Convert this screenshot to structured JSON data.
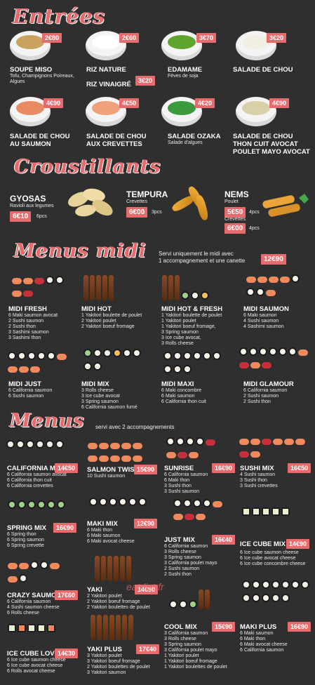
{
  "sections": {
    "entrees": "Entrées",
    "croustillants": "Croustillants",
    "menus_midi": "Menus midi",
    "menus": "Menus"
  },
  "entrees": [
    {
      "name": "SOUPE MISO",
      "sub": "Tofu, Champignons Poireaux, Algues",
      "price": "2€80",
      "color": "#c9a35d"
    },
    {
      "name": "RIZ NATURE",
      "sub": "",
      "price": "2€60",
      "color": "#ffffff"
    },
    {
      "name": "EDAMAME",
      "sub": "Fèves de soja",
      "price": "3€70",
      "color": "#5fa52c"
    },
    {
      "name": "SALADE DE CHOU",
      "sub": "",
      "price": "3€20",
      "color": "#f2efe3"
    },
    {
      "name": "SALADE DE CHOU AU SAUMON",
      "sub": "",
      "price": "4€90",
      "color": "#e88b63"
    },
    {
      "name": "SALADE DE CHOU AUX CREVETTES",
      "sub": "",
      "price": "4€50",
      "color": "#f0a07a"
    },
    {
      "name": "SALADE OZAKA",
      "sub": "Salade d'algues",
      "price": "4€20",
      "color": "#3b9a3c"
    },
    {
      "name": "SALADE DE CHOU THON CUIT AVOCAT POULET MAYO AVOCAT",
      "sub": "",
      "price": "4€90",
      "color": "#d9cfa9"
    }
  ],
  "riz_vinaigre": {
    "name": "RIZ VINAIGRÉ",
    "price": "3€20"
  },
  "croustillants": {
    "gyosas": {
      "name": "GYOSAS",
      "sub": "Ravioli aux legumes",
      "price": "6€10",
      "qty": "6pcs"
    },
    "tempura": {
      "name": "TEMPURA",
      "sub": "Crevettes",
      "price": "6€00",
      "qty": "3pcs"
    },
    "nems": {
      "name": "NEMS",
      "sub1": "Poulet",
      "price1": "5€50",
      "qty1": "4pcs",
      "sub2": "Crevettes",
      "price2": "6€00",
      "qty2": "4pcs"
    }
  },
  "menus_midi": {
    "note1": "Servi uniquement le midi avec",
    "note2": "1 accompagnement et une canette",
    "price": "12€90",
    "items": [
      {
        "name": "MIDI FRESH",
        "lines": [
          "6 Maki saumon avocat",
          "2 Sushi saumon",
          "2 Sushi thon",
          "3 Sashimi saumon",
          "3 Sashimi thon"
        ]
      },
      {
        "name": "MIDI HOT",
        "lines": [
          "1 Yakitori boulette de poulet",
          "2 Yakitori poulet",
          "2 Yakitori boeuf fromage"
        ]
      },
      {
        "name": "MIDI HOT & FRESH",
        "lines": [
          "1 Yakitori boulette de poulet",
          "1 Yakitori poulet",
          "1 Yakitori boeuf fromage,",
          "3 Spring saumon",
          "3 Ice cube avocat,",
          "3 Rolls cheese"
        ]
      },
      {
        "name": "MIDI SAUMON",
        "lines": [
          "6 Maki saumon",
          "4 Sushi saumon",
          "4 Sashimi saumon"
        ]
      },
      {
        "name": "MIDI JUST",
        "lines": [
          "6 California saumon",
          "6 Sushi saumon"
        ]
      },
      {
        "name": "MIDI MIX",
        "lines": [
          "3 Rolls cheese",
          "3 Ice cube avocat",
          "3 Spring saumon",
          "6 California saumon fumé"
        ]
      },
      {
        "name": "MIDI MAXI",
        "lines": [
          "6 Maki concombre",
          "6 Maki saumon",
          "6 California thon cuit"
        ]
      },
      {
        "name": "MIDI GLAMOUR",
        "lines": [
          "6 California saumon",
          "2 Sushi saumon",
          "2 Sushi thon"
        ]
      }
    ]
  },
  "menus": {
    "note": "servi avec 2 accompagnements",
    "items": [
      {
        "name": "CALIFORNIA MIX",
        "price": "14€50",
        "lines": [
          "6 California saumon avocat",
          "6 California thon cuit",
          "6 California crevettes"
        ]
      },
      {
        "name": "SALMON TWIST",
        "price": "15€90",
        "lines": [
          "10 Sushi saumon"
        ]
      },
      {
        "name": "SUNRISE",
        "price": "16€90",
        "lines": [
          "6 California saumon",
          "6 Maki thon",
          "3 Sushi thon",
          "3 Sushi saumon"
        ]
      },
      {
        "name": "SUSHI MIX",
        "price": "16€50",
        "lines": [
          "4 Sushi saumon",
          "3 Sushi thon",
          "3 Sushi crevettes"
        ]
      },
      {
        "name": "SPRING MIX",
        "price": "16€90",
        "lines": [
          "6 Spring thon",
          "6 Spring saumon",
          "6 Spring crevette"
        ]
      },
      {
        "name": "MAKI MIX",
        "price": "12€90",
        "lines": [
          "6 Maki thon",
          "6 Maki saumon",
          "6 Maki avocat cheese"
        ]
      },
      {
        "name": "JUST MIX",
        "price": "16€40",
        "lines": [
          "6 California saumon",
          "3 Rolls cheese",
          "3 Spring saumon",
          "3 California poulet mayo",
          "2 Sushi saumon",
          "2 Sushi thon"
        ]
      },
      {
        "name": "ICE CUBE MIX",
        "price": "14€90",
        "lines": [
          "6 Ice cube saumon cheese",
          "6 Ice cube avocat cheese",
          "6 Ice cube concombre cheese"
        ]
      },
      {
        "name": "CRAZY SAUMON",
        "price": "17€60",
        "lines": [
          "6 California saumon",
          "4 Sushi saumon cheese",
          "6 Rolls cheese"
        ]
      },
      {
        "name": "YAKI",
        "price": "14€90",
        "lines": [
          "2 Yakitori poulet",
          "2 Yakitori boeuf fromage",
          "2 Yakitori boulettes de poulet"
        ]
      },
      {
        "name": "COOL MIX",
        "price": "15€90",
        "lines": [
          "3 California saumon",
          "3 Rolls cheese",
          "3 Spring saumon",
          "3 California poulet mayo",
          "1 Yakitori poulet",
          "1 Yakitori boeuf fromage",
          "1 Yakitori boulettes de poulet"
        ]
      },
      {
        "name": "MAKI PLUS",
        "price": "16€90",
        "lines": [
          "6 Maki saumon",
          "6 Maki thon",
          "6 Maki avocat cheese",
          "6 California saumon"
        ]
      },
      {
        "name": "ICE CUBE LOVE",
        "price": "14€30",
        "lines": [
          "6 Ice cube saumon cheese",
          "6 Ice cube avocat cheese",
          "6 Rolls avocat cheese"
        ]
      },
      {
        "name": "YAKI PLUS",
        "price": "17€40",
        "lines": [
          "3 Yakitori poulet",
          "3 Yakitori boeuf fromage",
          "2 Yakitori boulettes de poulet",
          "3 Yakitori saumon"
        ]
      }
    ]
  },
  "watermark": "eat-list.fr",
  "colors": {
    "accent": "#e76a6c",
    "background": "#2f2f2f"
  }
}
